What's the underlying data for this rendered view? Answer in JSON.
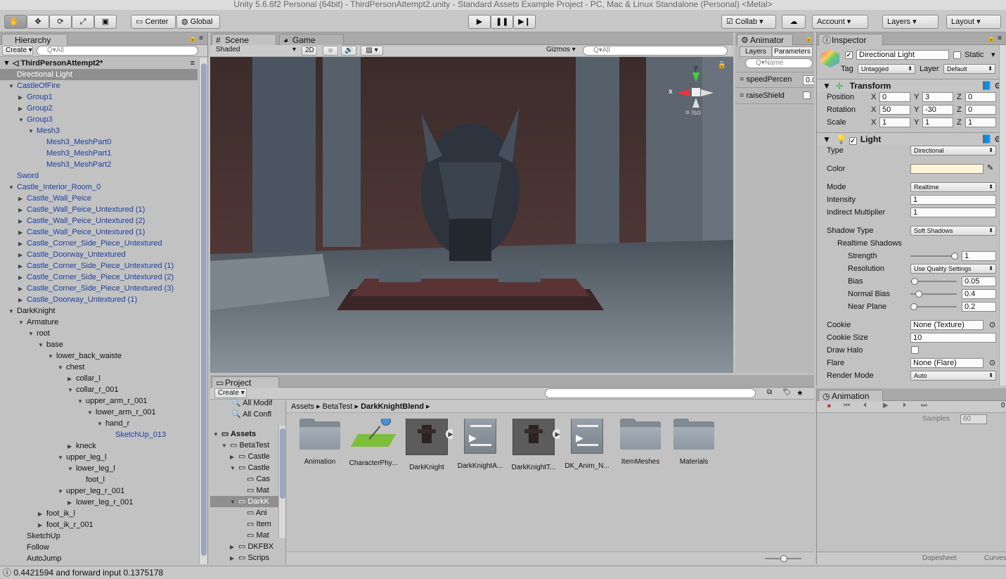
{
  "window_title": "Unity 5.6.6f2 Personal (64bit) - ThirdPersonAttempt2.unity - Standard Assets Example Project - PC, Mac & Linux Standalone (Personal) <Metal>",
  "toolbar": {
    "pivot": "Center",
    "space": "Global",
    "collab": "Collab",
    "account": "Account",
    "layers": "Layers",
    "layout": "Layout"
  },
  "hierarchy": {
    "tab": "Hierarchy",
    "create": "Create",
    "search_placeholder": "Q▾All",
    "scene": "ThirdPersonAttempt2*",
    "items": [
      {
        "label": "Directional Light",
        "indent": 1,
        "arrow": "",
        "selected": true,
        "blue": false
      },
      {
        "label": "CastleOfFire",
        "indent": 1,
        "arrow": "▼",
        "blue": true
      },
      {
        "label": "Group1",
        "indent": 2,
        "arrow": "▶",
        "blue": true
      },
      {
        "label": "Group2",
        "indent": 2,
        "arrow": "▶",
        "blue": true
      },
      {
        "label": "Group3",
        "indent": 2,
        "arrow": "▼",
        "blue": true
      },
      {
        "label": "Mesh3",
        "indent": 3,
        "arrow": "▼",
        "blue": true
      },
      {
        "label": "Mesh3_MeshPart0",
        "indent": 4,
        "arrow": "",
        "blue": true
      },
      {
        "label": "Mesh3_MeshPart1",
        "indent": 4,
        "arrow": "",
        "blue": true
      },
      {
        "label": "Mesh3_MeshPart2",
        "indent": 4,
        "arrow": "",
        "blue": true
      },
      {
        "label": "Sword",
        "indent": 1,
        "arrow": "",
        "blue": true
      },
      {
        "label": "Castle_Interior_Room_0",
        "indent": 1,
        "arrow": "▼",
        "blue": true
      },
      {
        "label": "Castle_Wall_Peice",
        "indent": 2,
        "arrow": "▶",
        "blue": true
      },
      {
        "label": "Castle_Wall_Peice_Untextured (1)",
        "indent": 2,
        "arrow": "▶",
        "blue": true
      },
      {
        "label": "Castle_Wall_Peice_Untextured (2)",
        "indent": 2,
        "arrow": "▶",
        "blue": true
      },
      {
        "label": "Castle_Wall_Peice_Untextured (1)",
        "indent": 2,
        "arrow": "▶",
        "blue": true
      },
      {
        "label": "Castle_Corner_Side_Piece_Untextured",
        "indent": 2,
        "arrow": "▶",
        "blue": true
      },
      {
        "label": "Castle_Doorway_Untextured",
        "indent": 2,
        "arrow": "▶",
        "blue": true
      },
      {
        "label": "Castle_Corner_Side_Piece_Untextured (1)",
        "indent": 2,
        "arrow": "▶",
        "blue": true
      },
      {
        "label": "Castle_Corner_Side_Piece_Untextured (2)",
        "indent": 2,
        "arrow": "▶",
        "blue": true
      },
      {
        "label": "Castle_Corner_Side_Piece_Untextured (3)",
        "indent": 2,
        "arrow": "▶",
        "blue": true
      },
      {
        "label": "Castle_Doorway_Untextured (1)",
        "indent": 2,
        "arrow": "▶",
        "blue": true
      },
      {
        "label": "DarkKnight",
        "indent": 1,
        "arrow": "▼",
        "blue": false
      },
      {
        "label": "Armature",
        "indent": 2,
        "arrow": "▼",
        "blue": false
      },
      {
        "label": "root",
        "indent": 3,
        "arrow": "▼",
        "blue": false
      },
      {
        "label": "base",
        "indent": 4,
        "arrow": "▼",
        "blue": false
      },
      {
        "label": "lower_back_waiste",
        "indent": 5,
        "arrow": "▼",
        "blue": false
      },
      {
        "label": "chest",
        "indent": 6,
        "arrow": "▼",
        "blue": false
      },
      {
        "label": "collar_l",
        "indent": 7,
        "arrow": "▶",
        "blue": false
      },
      {
        "label": "collar_r_001",
        "indent": 7,
        "arrow": "▼",
        "blue": false
      },
      {
        "label": "upper_arm_r_001",
        "indent": 8,
        "arrow": "▼",
        "blue": false
      },
      {
        "label": "lower_arm_r_001",
        "indent": 9,
        "arrow": "▼",
        "blue": false
      },
      {
        "label": "hand_r",
        "indent": 10,
        "arrow": "▼",
        "blue": false
      },
      {
        "label": "SketchUp_013",
        "indent": 11,
        "arrow": "",
        "blue": true
      },
      {
        "label": "kneck",
        "indent": 7,
        "arrow": "▶",
        "blue": false
      },
      {
        "label": "upper_leg_l",
        "indent": 6,
        "arrow": "▼",
        "blue": false
      },
      {
        "label": "lower_leg_l",
        "indent": 7,
        "arrow": "▼",
        "blue": false
      },
      {
        "label": "foot_l",
        "indent": 8,
        "arrow": "",
        "blue": false
      },
      {
        "label": "upper_leg_r_001",
        "indent": 6,
        "arrow": "▼",
        "blue": false
      },
      {
        "label": "lower_leg_r_001",
        "indent": 7,
        "arrow": "▶",
        "blue": false
      },
      {
        "label": "foot_ik_l",
        "indent": 4,
        "arrow": "▶",
        "blue": false
      },
      {
        "label": "foot_ik_r_001",
        "indent": 4,
        "arrow": "▶",
        "blue": false
      },
      {
        "label": "SketchUp",
        "indent": 2,
        "arrow": "",
        "blue": false
      },
      {
        "label": "Follow",
        "indent": 2,
        "arrow": "",
        "blue": false
      },
      {
        "label": "AutoJump",
        "indent": 2,
        "arrow": "",
        "blue": false
      }
    ]
  },
  "scene": {
    "tab_scene": "Scene",
    "tab_game": "Game",
    "shading": "Shaded",
    "mode2d": "2D",
    "gizmos": "Gizmos",
    "search_placeholder": "Q▾All",
    "gizmo_x": "x",
    "gizmo_y": "y",
    "gizmo_persp": "Iso"
  },
  "animator": {
    "tab": "Animator",
    "layers": "Layers",
    "parameters": "Parameters",
    "search_placeholder": "Q▾Name",
    "params": [
      {
        "name": "speedPercen",
        "value": "0.0"
      },
      {
        "name": "raiseShield",
        "value": ""
      }
    ]
  },
  "inspector": {
    "tab": "Inspector",
    "object_name": "Directional Light",
    "static": "Static",
    "tag_label": "Tag",
    "tag": "Untagged",
    "layer_label": "Layer",
    "layer": "Default",
    "transform": {
      "title": "Transform",
      "position_label": "Position",
      "rotation_label": "Rotation",
      "scale_label": "Scale",
      "position": [
        "0",
        "3",
        "0"
      ],
      "rotation": [
        "50",
        "-30",
        "0"
      ],
      "scale": [
        "1",
        "1",
        "1"
      ],
      "axes": [
        "X",
        "Y",
        "Z"
      ]
    },
    "light": {
      "title": "Light",
      "type_label": "Type",
      "type": "Directional",
      "color_label": "Color",
      "color": "#fff4d6",
      "mode_label": "Mode",
      "mode": "Realtime",
      "intensity_label": "Intensity",
      "intensity": "1",
      "indirect_label": "Indirect Multiplier",
      "indirect": "1",
      "shadow_type_label": "Shadow Type",
      "shadow_type": "Soft Shadows",
      "realtime_shadows_label": "Realtime Shadows",
      "strength_label": "Strength",
      "strength": "1",
      "resolution_label": "Resolution",
      "resolution": "Use Quality Settings",
      "bias_label": "Bias",
      "bias": "0.05",
      "normal_bias_label": "Normal Bias",
      "normal_bias": "0.4",
      "near_plane_label": "Near Plane",
      "near_plane": "0.2",
      "cookie_label": "Cookie",
      "cookie": "None (Texture)",
      "cookie_size_label": "Cookie Size",
      "cookie_size": "10",
      "draw_halo_label": "Draw Halo",
      "flare_label": "Flare",
      "flare": "None (Flare)",
      "render_mode_label": "Render Mode",
      "render_mode": "Auto"
    }
  },
  "animation": {
    "tab": "Animation",
    "samples_label": "Samples",
    "samples": "60",
    "frame": "0",
    "dopesheet": "Dopesheet",
    "curves": "Curves"
  },
  "project": {
    "tab": "Project",
    "create": "Create",
    "favorites": [
      "All Modif",
      "All Confl"
    ],
    "tree": [
      {
        "label": "Assets",
        "indent": 0,
        "arrow": "▼",
        "bold": true
      },
      {
        "label": "BetaTest",
        "indent": 1,
        "arrow": "▼"
      },
      {
        "label": "Castle",
        "indent": 2,
        "arrow": "▶"
      },
      {
        "label": "Castle",
        "indent": 2,
        "arrow": "▼"
      },
      {
        "label": "Cas",
        "indent": 3,
        "arrow": ""
      },
      {
        "label": "Mat",
        "indent": 3,
        "arrow": ""
      },
      {
        "label": "DarkK",
        "indent": 2,
        "arrow": "▼",
        "selected": true
      },
      {
        "label": "Ani",
        "indent": 3,
        "arrow": ""
      },
      {
        "label": "Item",
        "indent": 3,
        "arrow": ""
      },
      {
        "label": "Mat",
        "indent": 3,
        "arrow": ""
      },
      {
        "label": "DKFBX",
        "indent": 2,
        "arrow": "▶"
      },
      {
        "label": "Scrips",
        "indent": 2,
        "arrow": "▶"
      }
    ],
    "breadcrumb": [
      "Assets",
      "BetaTest",
      "DarkKnightBlend"
    ],
    "assets": [
      {
        "label": "Animation",
        "kind": "folder"
      },
      {
        "label": "CharacterPhy...",
        "kind": "physics"
      },
      {
        "label": "DarkKnight",
        "kind": "model"
      },
      {
        "label": "DarkKnightA...",
        "kind": "controller"
      },
      {
        "label": "DarkKnightT...",
        "kind": "model"
      },
      {
        "label": "DK_Anim_N...",
        "kind": "controller"
      },
      {
        "label": "ItemMeshes",
        "kind": "folder"
      },
      {
        "label": "Materials",
        "kind": "folder"
      }
    ]
  },
  "status": "0.4421594 and forward input 0.1375178",
  "colors": {
    "panel": "#c2c2c2",
    "selection": "#8f8f8f",
    "link_blue": "#1d3fa0",
    "gizmo_x": "#e33",
    "gizmo_y": "#4c4"
  }
}
